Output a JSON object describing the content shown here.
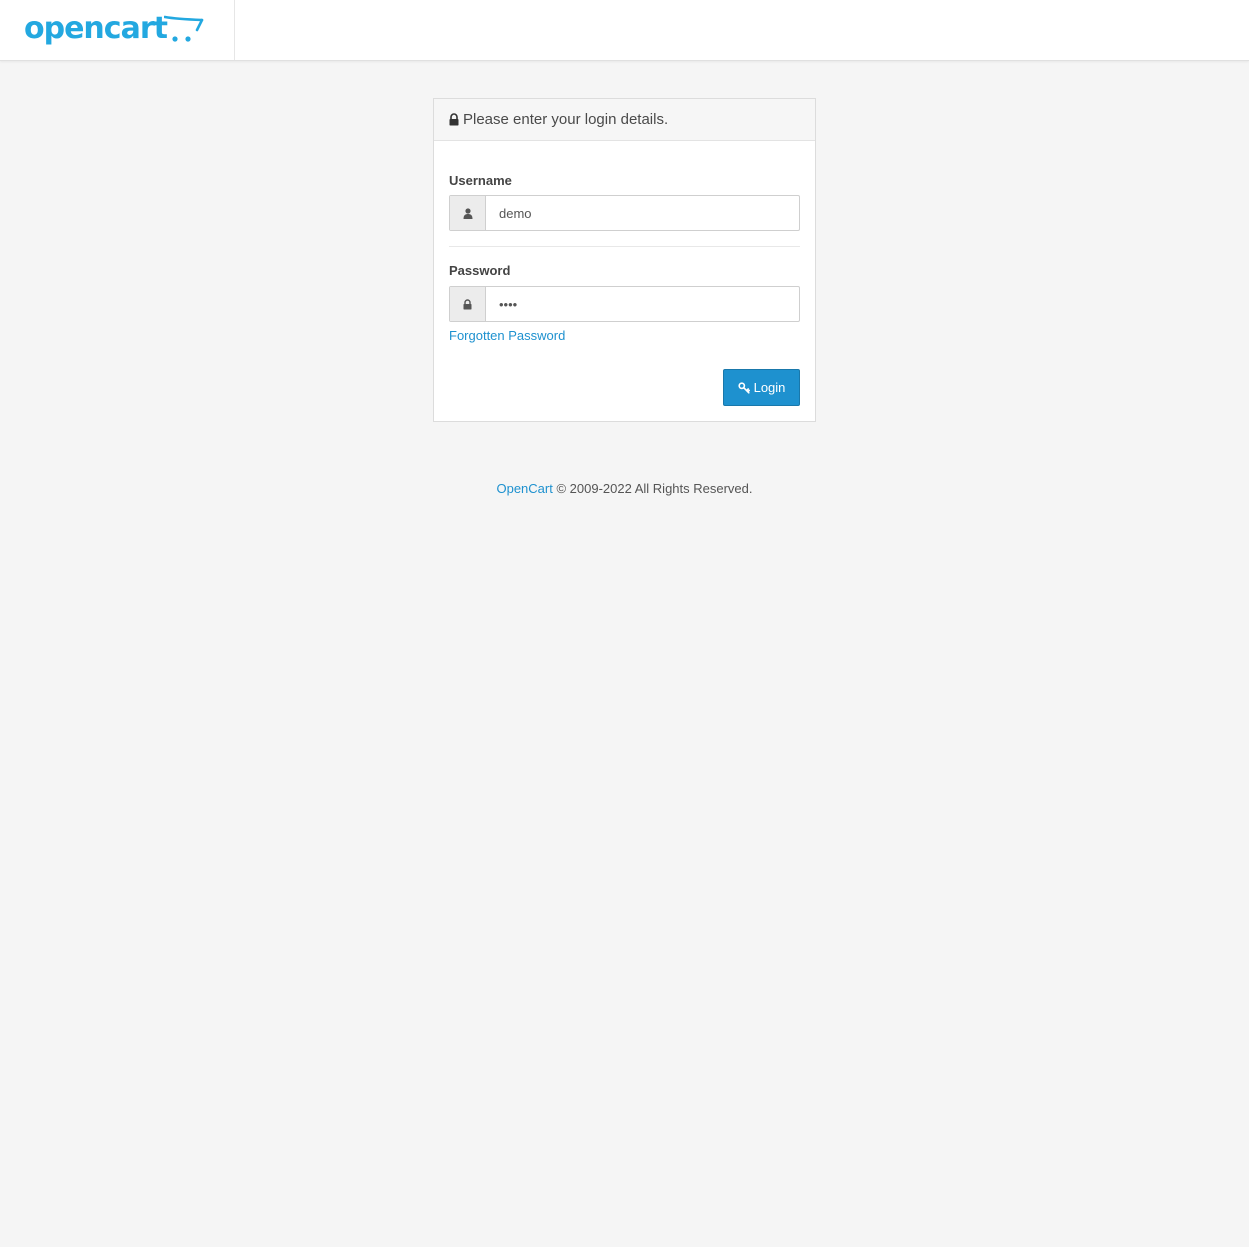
{
  "brand": {
    "logo_text": "opencart",
    "accent_color": "#23a8e0"
  },
  "login_panel": {
    "title": "Please enter your login details.",
    "username": {
      "label": "Username",
      "value": "demo",
      "icon": "user-icon"
    },
    "password": {
      "label": "Password",
      "value": "demo",
      "icon": "lock-icon"
    },
    "forgot_link": "Forgotten Password",
    "login_button": "Login",
    "button_color": "#1e91cf"
  },
  "footer": {
    "link_text": "OpenCart",
    "rest_text": "© 2009-2022 All Rights Reserved."
  }
}
